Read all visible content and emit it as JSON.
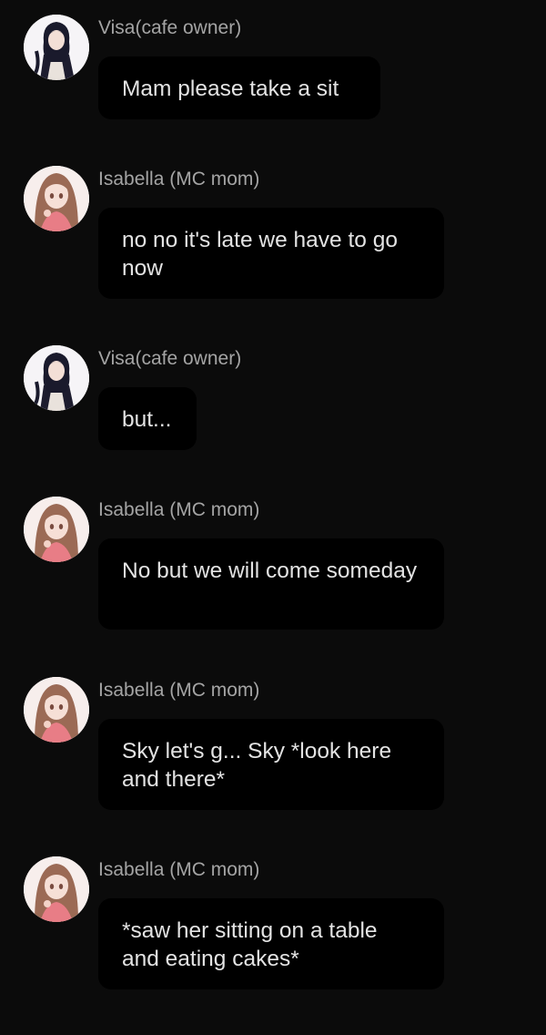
{
  "messages": [
    {
      "author": "Visa(cafe owner)",
      "text": "Mam please take a sit",
      "avatar": "visa-avatar"
    },
    {
      "author": "Isabella (MC mom)",
      "text": "no no it's late we have to go now",
      "avatar": "isabella-avatar"
    },
    {
      "author": "Visa(cafe owner)",
      "text": "but...",
      "avatar": "visa-avatar"
    },
    {
      "author": "Isabella (MC mom)",
      "text": "No but we will come someday",
      "avatar": "isabella-avatar"
    },
    {
      "author": "Isabella (MC mom)",
      "text": "Sky let's g... Sky *look here and there*",
      "avatar": "isabella-avatar"
    },
    {
      "author": "Isabella (MC mom)",
      "text": "*saw her sitting on a table and eating cakes*",
      "avatar": "isabella-avatar"
    }
  ],
  "colors": {
    "background": "#0b0b0b",
    "bubble": "#000000",
    "author_text": "#a4a4a4",
    "message_text": "#e3e3e3"
  }
}
